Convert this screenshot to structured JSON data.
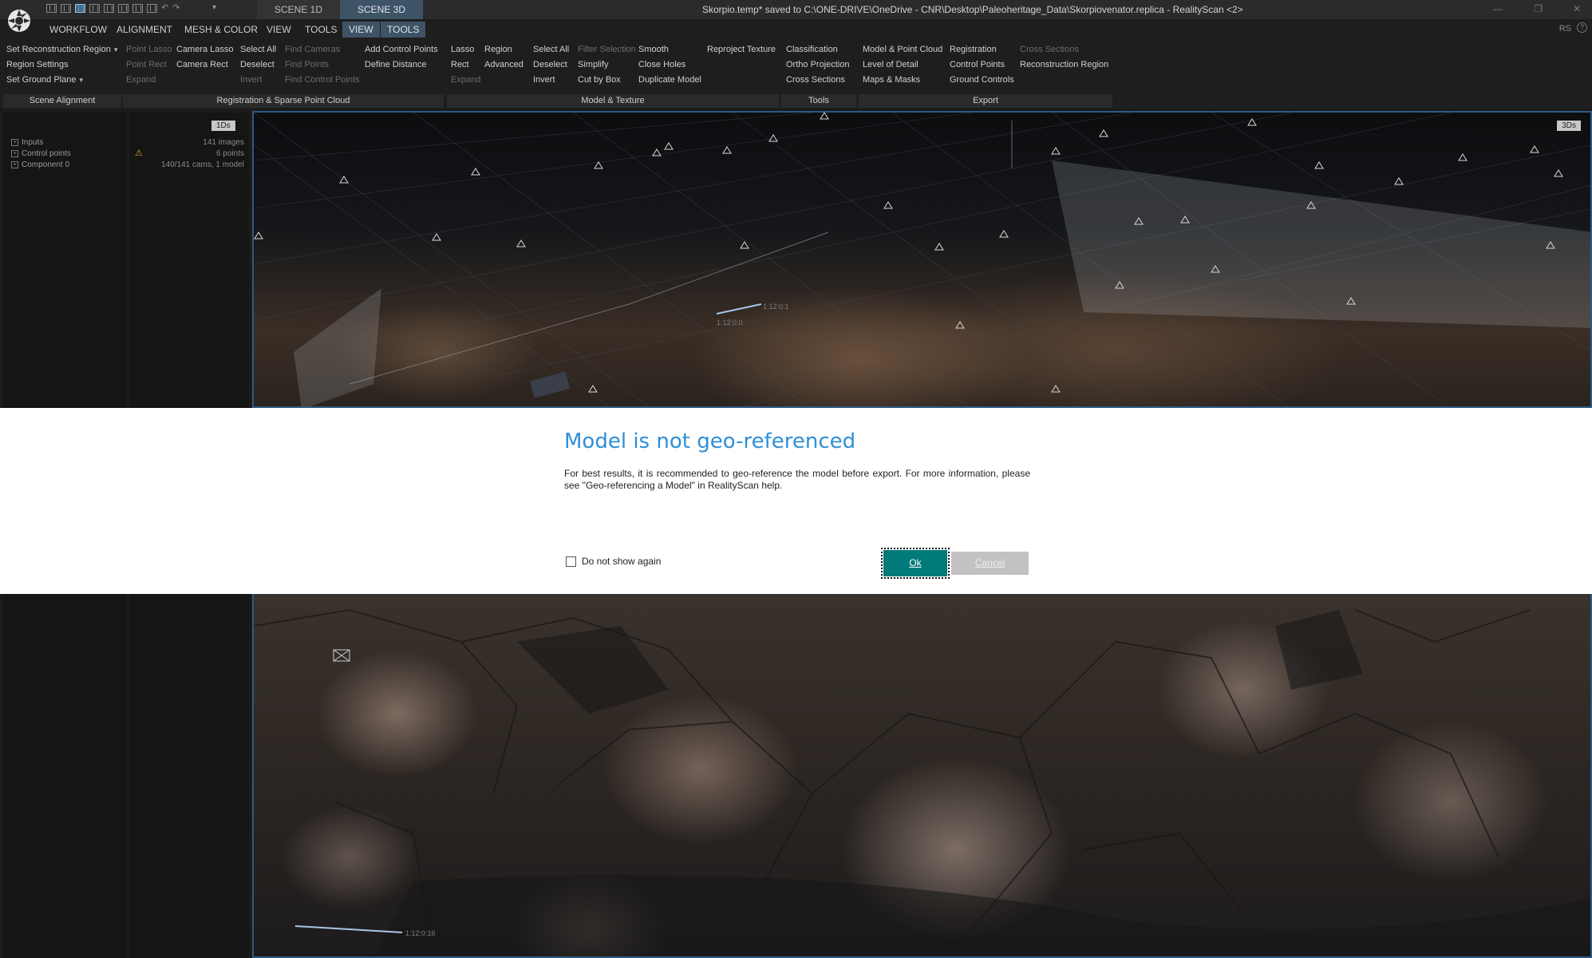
{
  "app": {
    "quick_access_menu_glyph": "▾",
    "window_title": "Skorpio.temp* saved to C:\\ONE-DRIVE\\OneDrive - CNR\\Desktop\\Paleoheritage_Data\\Skorpiovenator.replica - RealityScan <2>",
    "scene_tabs": [
      "SCENE 1D",
      "SCENE 3D"
    ],
    "corner_label": "RS",
    "help_glyph": "?"
  },
  "ribbon_tabs": [
    "WORKFLOW",
    "ALIGNMENT",
    "MESH & COLOR",
    "VIEW",
    "TOOLS",
    "VIEW",
    "TOOLS"
  ],
  "ribbon": {
    "scene_alignment": {
      "label": "Scene Alignment",
      "items": [
        "Set Reconstruction Region",
        "Region Settings",
        "Set Ground Plane"
      ]
    },
    "registration": {
      "label": "Registration & Sparse Point Cloud",
      "items": [
        "Point Lasso",
        "Point Rect",
        "Expand",
        "Camera Lasso",
        "Camera Rect",
        "Select All",
        "Deselect",
        "Invert",
        "Find Cameras",
        "Find Points",
        "Find Control Points",
        "Add Control Points",
        "Define Distance"
      ]
    },
    "model_texture": {
      "label": "Model & Texture",
      "items": [
        "Lasso",
        "Rect",
        "Expand",
        "Region",
        "Advanced",
        "Select All",
        "Deselect",
        "Invert",
        "Filter Selection",
        "Simplify",
        "Cut by Box",
        "Smooth",
        "Close Holes",
        "Duplicate Model",
        "Reproject Texture"
      ]
    },
    "tools": {
      "label": "Tools",
      "items": [
        "Classification",
        "Ortho Projection",
        "Cross Sections"
      ]
    },
    "export": {
      "label": "Export",
      "items": [
        "Model & Point Cloud",
        "Level of Detail",
        "Maps & Masks",
        "Registration",
        "Control Points",
        "Ground Controls",
        "Cross Sections",
        "Reconstruction Region"
      ]
    }
  },
  "panel_1ds": {
    "badge": "1Ds",
    "tree": [
      {
        "label": "Inputs",
        "value": "141 images"
      },
      {
        "label": "Control points",
        "value": "6 points"
      },
      {
        "label": "Component 0",
        "value": "140/141 cams, 1 model"
      }
    ]
  },
  "viewport": {
    "badge": "3Ds",
    "scale_labels": [
      "1:12:0:1",
      "1:12:0:0",
      "1:12:0:16"
    ]
  },
  "dialog": {
    "title": "Model is not geo-referenced",
    "message": "For best results, it is recommended to geo-reference the model before export. For more information, please see \"Geo-referencing a Model\" in RealityScan help.",
    "checkbox_label": "Do not show again",
    "checkbox_checked": false,
    "ok_label": "Ok",
    "cancel_label": "Cancel"
  },
  "colors": {
    "accent": "#007a7a",
    "dialog_title": "#2f8fd6",
    "viewport_border": "#2e5a82",
    "warning": "#d8a516"
  }
}
